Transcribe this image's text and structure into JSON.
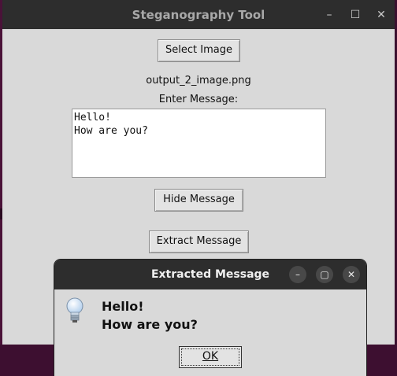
{
  "main_window": {
    "title": "Steganography Tool",
    "controls": {
      "minimize": "–",
      "maximize": "☐",
      "close": "✕"
    },
    "select_button": "Select Image",
    "file_label": "output_2_image.png",
    "enter_label": "Enter Message:",
    "message_text": "Hello!\nHow are you?",
    "hide_button": "Hide Message",
    "extract_button": "Extract Message"
  },
  "dialog": {
    "title": "Extracted Message",
    "controls": {
      "minimize": "–",
      "maximize": "▢",
      "close": "✕"
    },
    "icon": "lightbulb-icon",
    "message": "Hello!\nHow are you?",
    "ok_label": "OK"
  }
}
